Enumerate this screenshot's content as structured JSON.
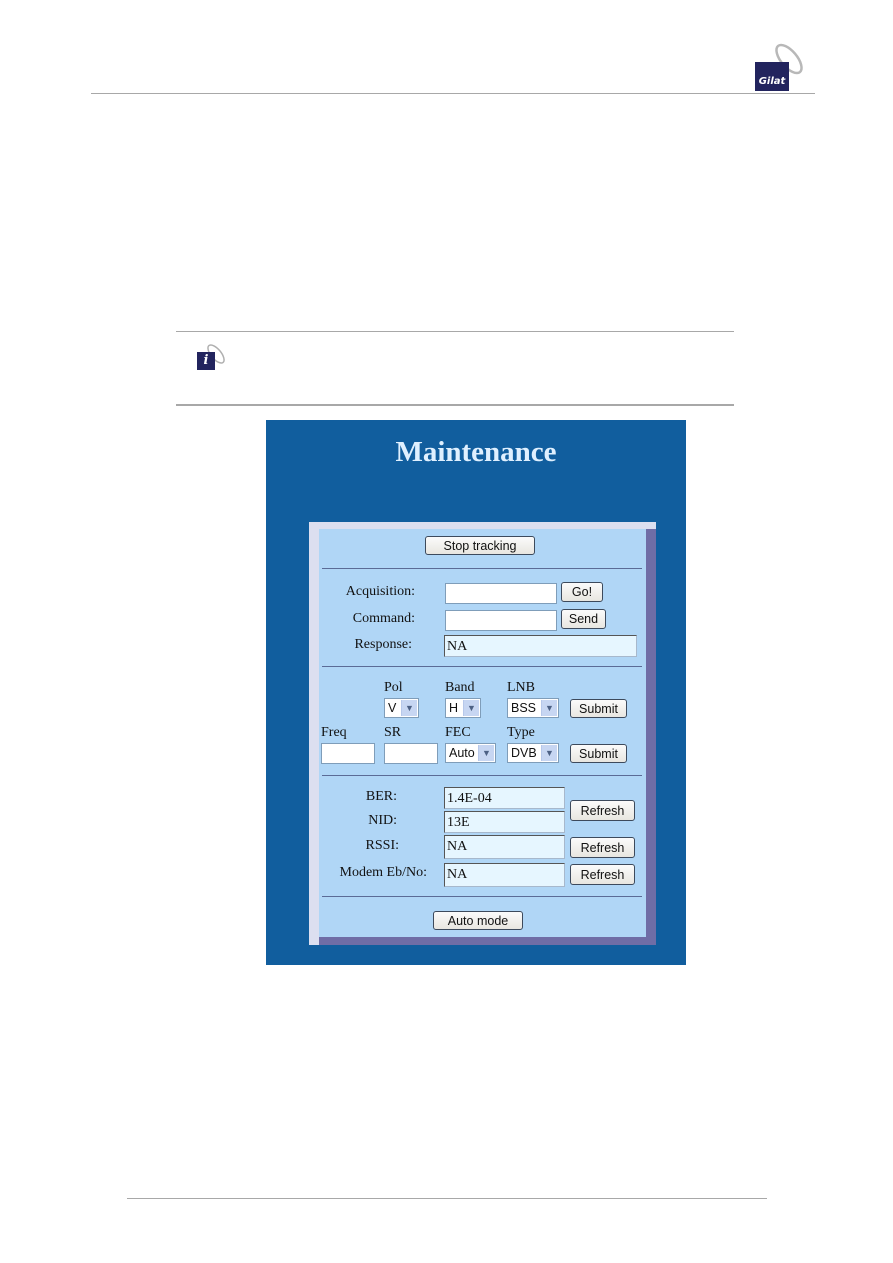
{
  "document": {
    "logo_text": "Gilat",
    "info_icon_glyph": "i"
  },
  "screenshot": {
    "title": "Maintenance",
    "stop_tracking_label": "Stop tracking",
    "acquisition": {
      "label": "Acquisition:",
      "value": "",
      "button": "Go!"
    },
    "command": {
      "label": "Command:",
      "value": "",
      "button": "Send"
    },
    "response": {
      "label": "Response:",
      "value": "NA"
    },
    "tuning": {
      "pol": {
        "label": "Pol",
        "value": "V"
      },
      "band": {
        "label": "Band",
        "value": "H"
      },
      "lnb": {
        "label": "LNB",
        "value": "BSS"
      },
      "submit1": "Submit",
      "freq": {
        "label": "Freq",
        "value": ""
      },
      "sr": {
        "label": "SR",
        "value": ""
      },
      "fec": {
        "label": "FEC",
        "value": "Auto"
      },
      "type": {
        "label": "Type",
        "value": "DVB"
      },
      "submit2": "Submit"
    },
    "status": {
      "ber": {
        "label": "BER:",
        "value": "1.4E-04"
      },
      "nid": {
        "label": "NID:",
        "value": "13E"
      },
      "ber_nid_refresh": "Refresh",
      "rssi": {
        "label": "RSSI:",
        "value": "NA",
        "button": "Refresh"
      },
      "ebno": {
        "label": "Modem Eb/No:",
        "value": "NA",
        "button": "Refresh"
      }
    },
    "auto_mode_label": "Auto mode"
  }
}
